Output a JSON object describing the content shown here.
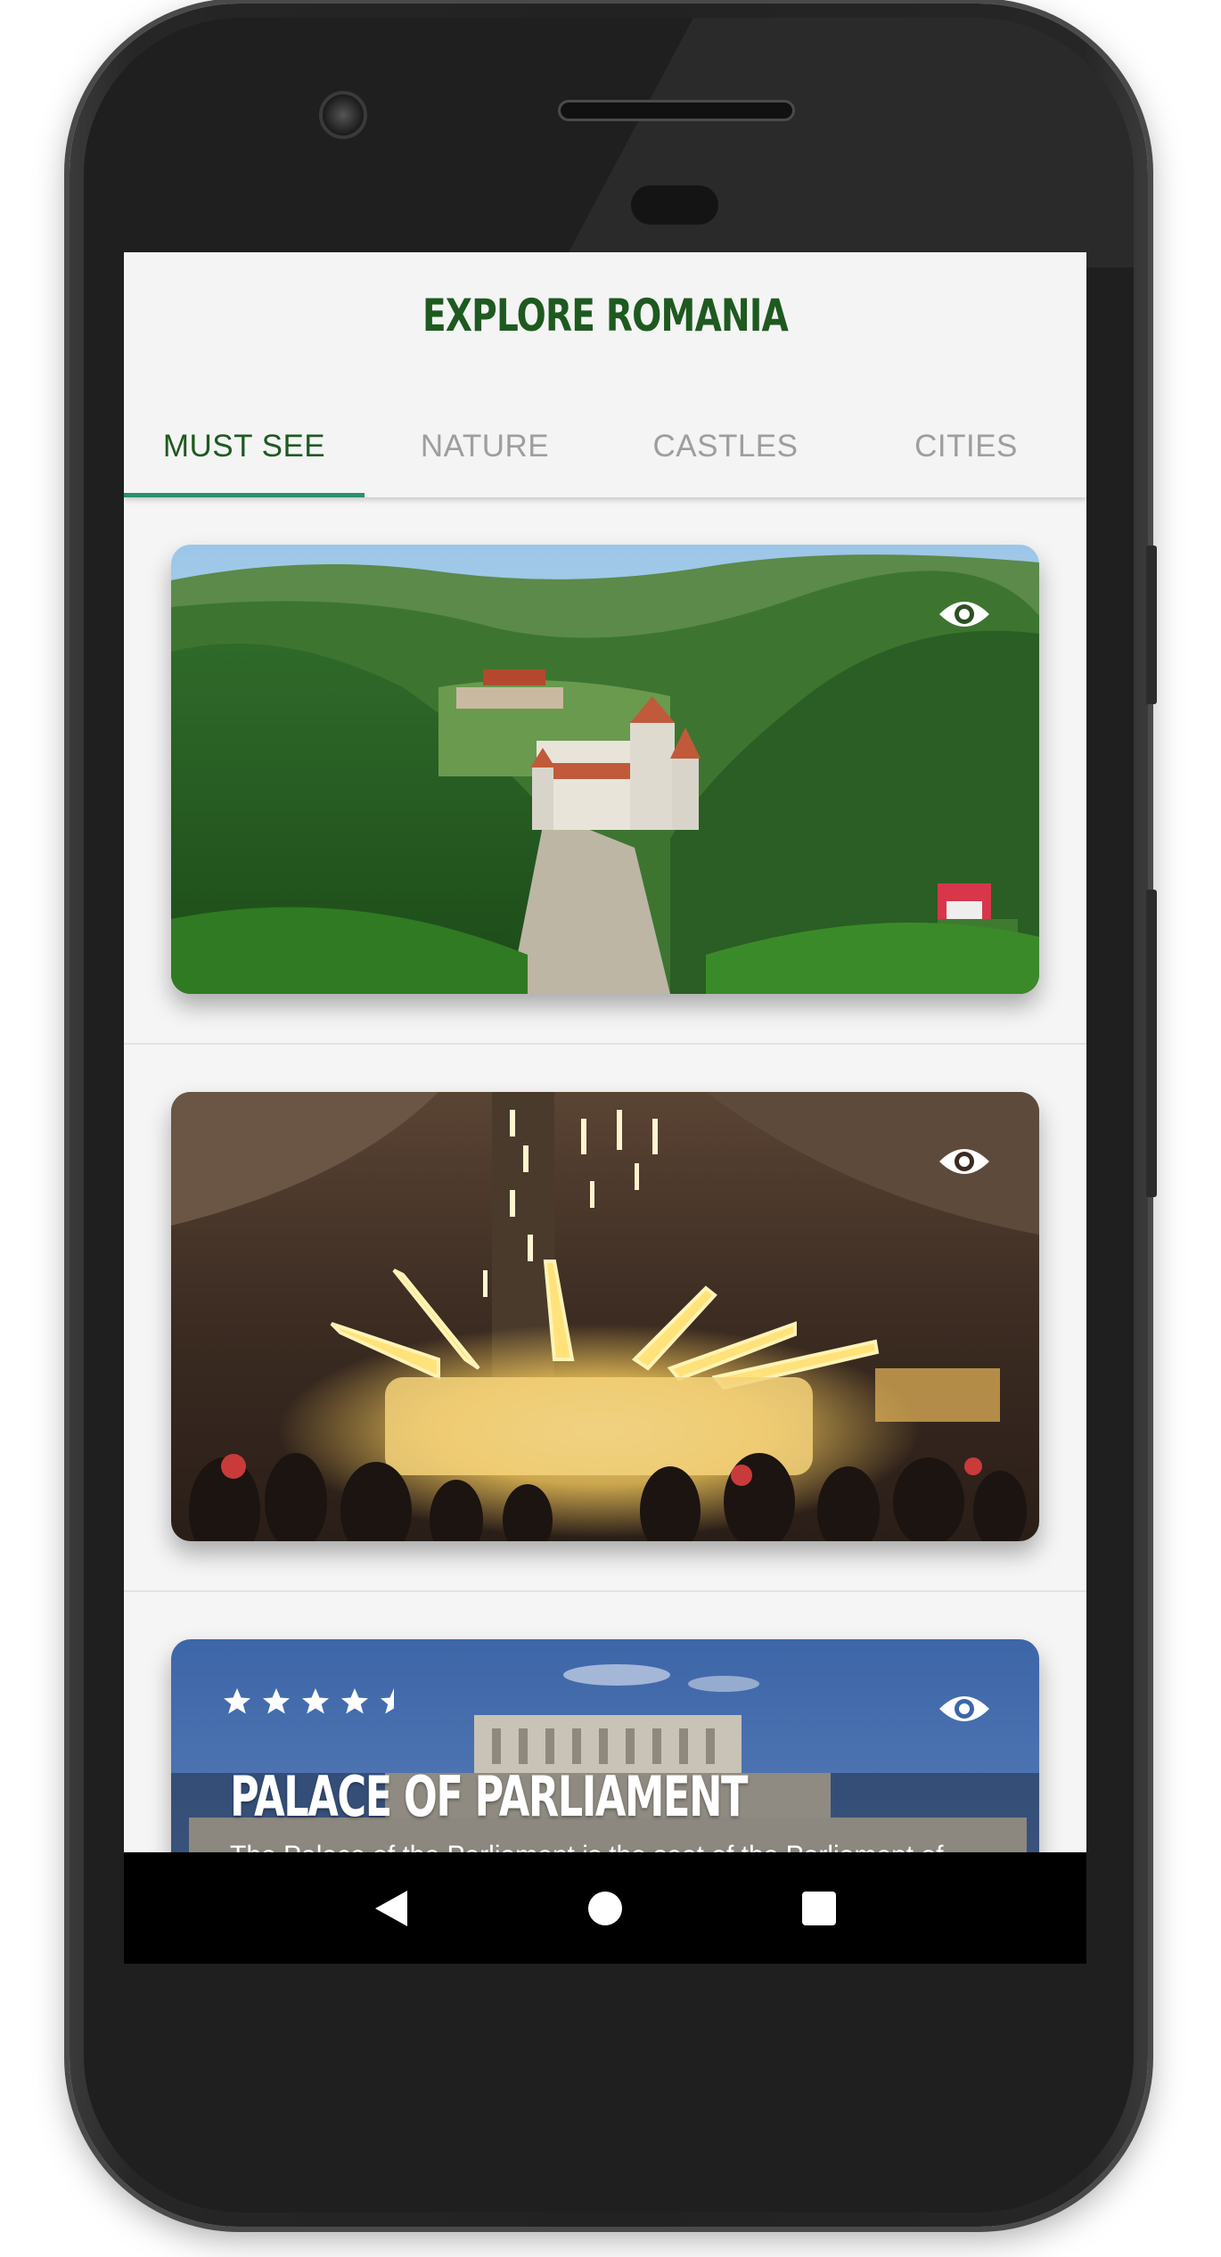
{
  "app": {
    "title": "EXPLORE ROMANIA"
  },
  "tabs": [
    {
      "label": "MUST SEE",
      "active": true
    },
    {
      "label": "NATURE",
      "active": false
    },
    {
      "label": "CASTLES",
      "active": false
    },
    {
      "label": "CITIES",
      "active": false
    }
  ],
  "cards": [
    {
      "icon": "eye-icon",
      "scene": "castle-on-forested-hill"
    },
    {
      "icon": "eye-icon",
      "scene": "illuminated-salt-mine-interior"
    },
    {
      "icon": "eye-icon",
      "scene": "palace-building-blue-sky",
      "rating": 4.5,
      "title": "PALACE OF PARLIAMENT",
      "description": "The Palace of the Parliament is the seat of the Parliament of"
    }
  ],
  "navbar": {
    "buttons": [
      "back-icon",
      "home-icon",
      "recents-icon"
    ]
  },
  "colors": {
    "title_green": "#1e5a20",
    "tab_indicator": "#2a8f73",
    "tab_inactive": "#9e9e9e"
  }
}
